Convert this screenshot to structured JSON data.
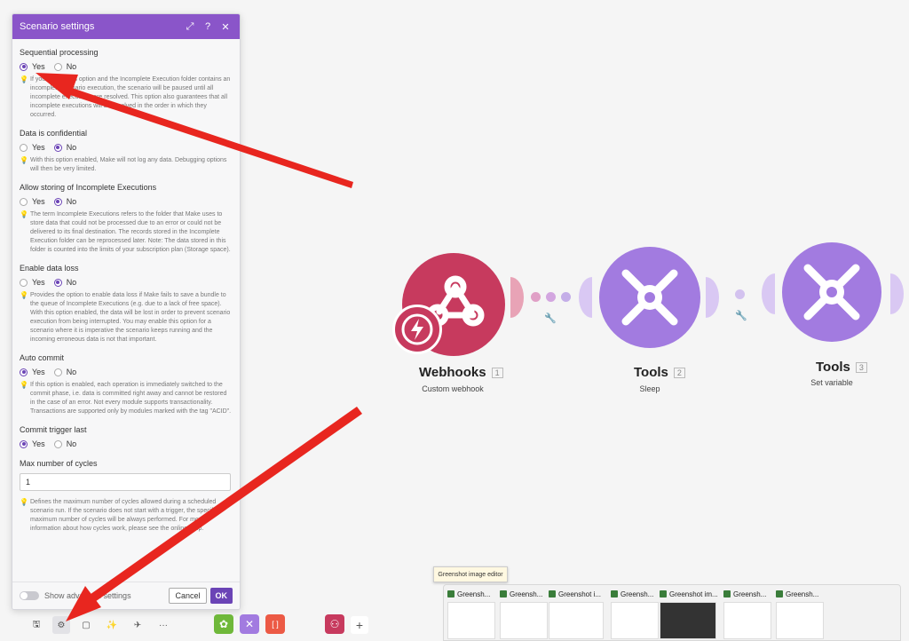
{
  "panel": {
    "title": "Scenario settings",
    "header_icons": [
      "expand-icon",
      "help-icon",
      "close-icon"
    ],
    "sections": [
      {
        "id": "sequential",
        "title": "Sequential processing",
        "options": [
          "Yes",
          "No"
        ],
        "selected": "Yes",
        "hint": "If you enable this option and the Incomplete Execution folder contains an incomplete scenario execution, the scenario will be paused until all incomplete executions are resolved. This option also guarantees that all incomplete executions will be resolved in the order in which they occurred."
      },
      {
        "id": "confidential",
        "title": "Data is confidential",
        "options": [
          "Yes",
          "No"
        ],
        "selected": "No",
        "hint": "With this option enabled, Make will not log any data. Debugging options will then be very limited."
      },
      {
        "id": "incomplete",
        "title": "Allow storing of Incomplete Executions",
        "options": [
          "Yes",
          "No"
        ],
        "selected": "No",
        "hint": "The term Incomplete Executions refers to the folder that Make uses to store data that could not be processed due to an error or could not be delivered to its final destination. The records stored in the Incomplete Execution folder can be reprocessed later. Note: The data stored in this folder is counted into the limits of your subscription plan (Storage space)."
      },
      {
        "id": "dataloss",
        "title": "Enable data loss",
        "options": [
          "Yes",
          "No"
        ],
        "selected": "No",
        "hint": "Provides the option to enable data loss if Make fails to save a bundle to the queue of Incomplete Executions (e.g. due to a lack of free space). With this option enabled, the data will be lost in order to prevent scenario execution from being interrupted. You may enable this option for a scenario where it is imperative the scenario keeps running and the incoming erroneous data is not that important."
      },
      {
        "id": "autocommit",
        "title": "Auto commit",
        "options": [
          "Yes",
          "No"
        ],
        "selected": "Yes",
        "hint": "If this option is enabled, each operation is immediately switched to the commit phase, i.e. data is committed right away and cannot be restored in the case of an error. Not every module supports transactionality. Transactions are supported only by modules marked with the tag \"ACID\"."
      },
      {
        "id": "committrigger",
        "title": "Commit trigger last",
        "options": [
          "Yes",
          "No"
        ],
        "selected": "Yes",
        "hint": ""
      }
    ],
    "max_cycles": {
      "title": "Max number of cycles",
      "value": "1",
      "hint": "Defines the maximum number of cycles allowed during a scheduled scenario run. If the scenario does not start with a trigger, the specified maximum number of cycles will be always performed. For more information about how cycles work, please see the online Help."
    },
    "footer": {
      "toggle_label": "Show advanced settings",
      "cancel": "Cancel",
      "ok": "OK"
    }
  },
  "modules": [
    {
      "name": "Webhooks",
      "number": "1",
      "subtitle": "Custom webhook",
      "color": "#c73a5e"
    },
    {
      "name": "Tools",
      "number": "2",
      "subtitle": "Sleep",
      "color": "#a27be0"
    },
    {
      "name": "Tools",
      "number": "3",
      "subtitle": "Set variable",
      "color": "#a27be0"
    }
  ],
  "toolbar": {
    "buttons": [
      "save-icon",
      "gear-icon",
      "notes-icon",
      "magic-wand-icon",
      "airplane-icon",
      "more-icon"
    ],
    "more_label": "···",
    "plus_label": "+"
  },
  "taskbar": {
    "tooltip": "Greenshot image editor",
    "items": [
      "Greensh...",
      "Greensh...",
      "Greenshot i...",
      "Greensh...",
      "Greenshot im...",
      "Greensh...",
      "Greensh..."
    ]
  },
  "colors": {
    "accent": "#6b44b6",
    "header": "#8a55c9",
    "arrow": "#e8261f"
  }
}
